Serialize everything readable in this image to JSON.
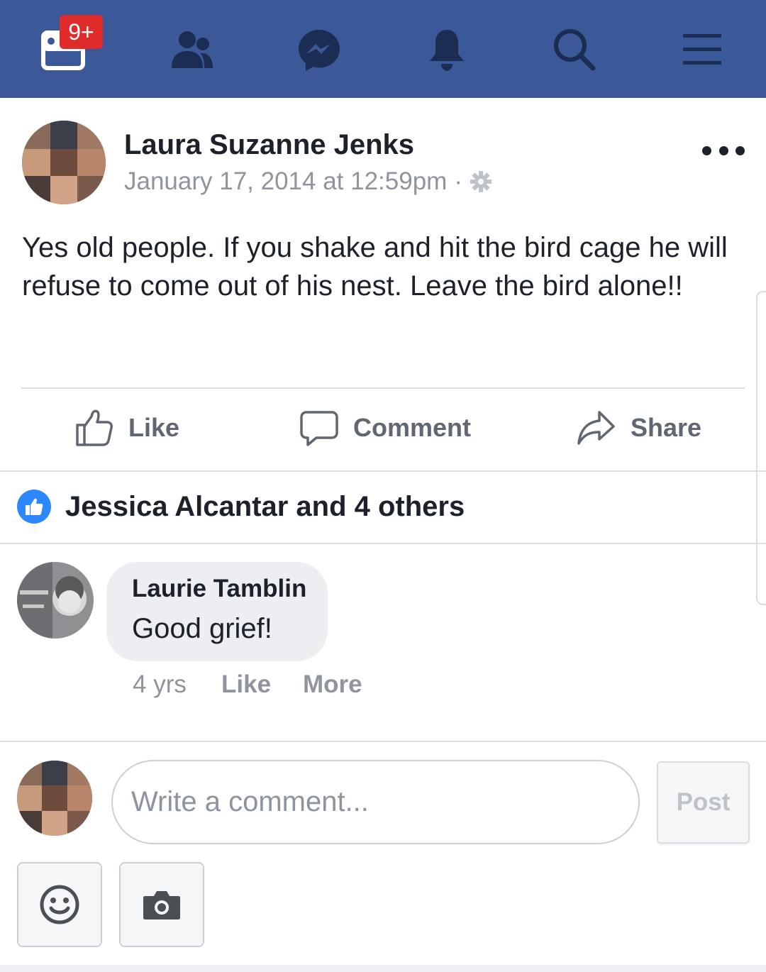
{
  "nav": {
    "notifications_badge": "9+",
    "icons": [
      "feed-icon",
      "friends-icon",
      "messenger-icon",
      "bell-icon",
      "search-icon",
      "menu-icon"
    ]
  },
  "post": {
    "author": "Laura Suzanne Jenks",
    "timestamp": "January 17, 2014 at 12:59pm",
    "separator": "·",
    "text": "Yes old people. If you shake and hit the bird cage he will refuse to come out of his nest. Leave the bird alone!!"
  },
  "actions": {
    "like": "Like",
    "comment": "Comment",
    "share": "Share"
  },
  "reactions": {
    "summary": "Jessica Alcantar and 4 others"
  },
  "comment": {
    "author": "Laurie Tamblin",
    "text": "Good grief!",
    "age": "4 yrs",
    "like": "Like",
    "more": "More"
  },
  "composer": {
    "placeholder": "Write a comment...",
    "post_label": "Post"
  },
  "colors": {
    "brand": "#3b5998",
    "like_blue": "#2d88ff",
    "badge_red": "#e02b2b"
  }
}
